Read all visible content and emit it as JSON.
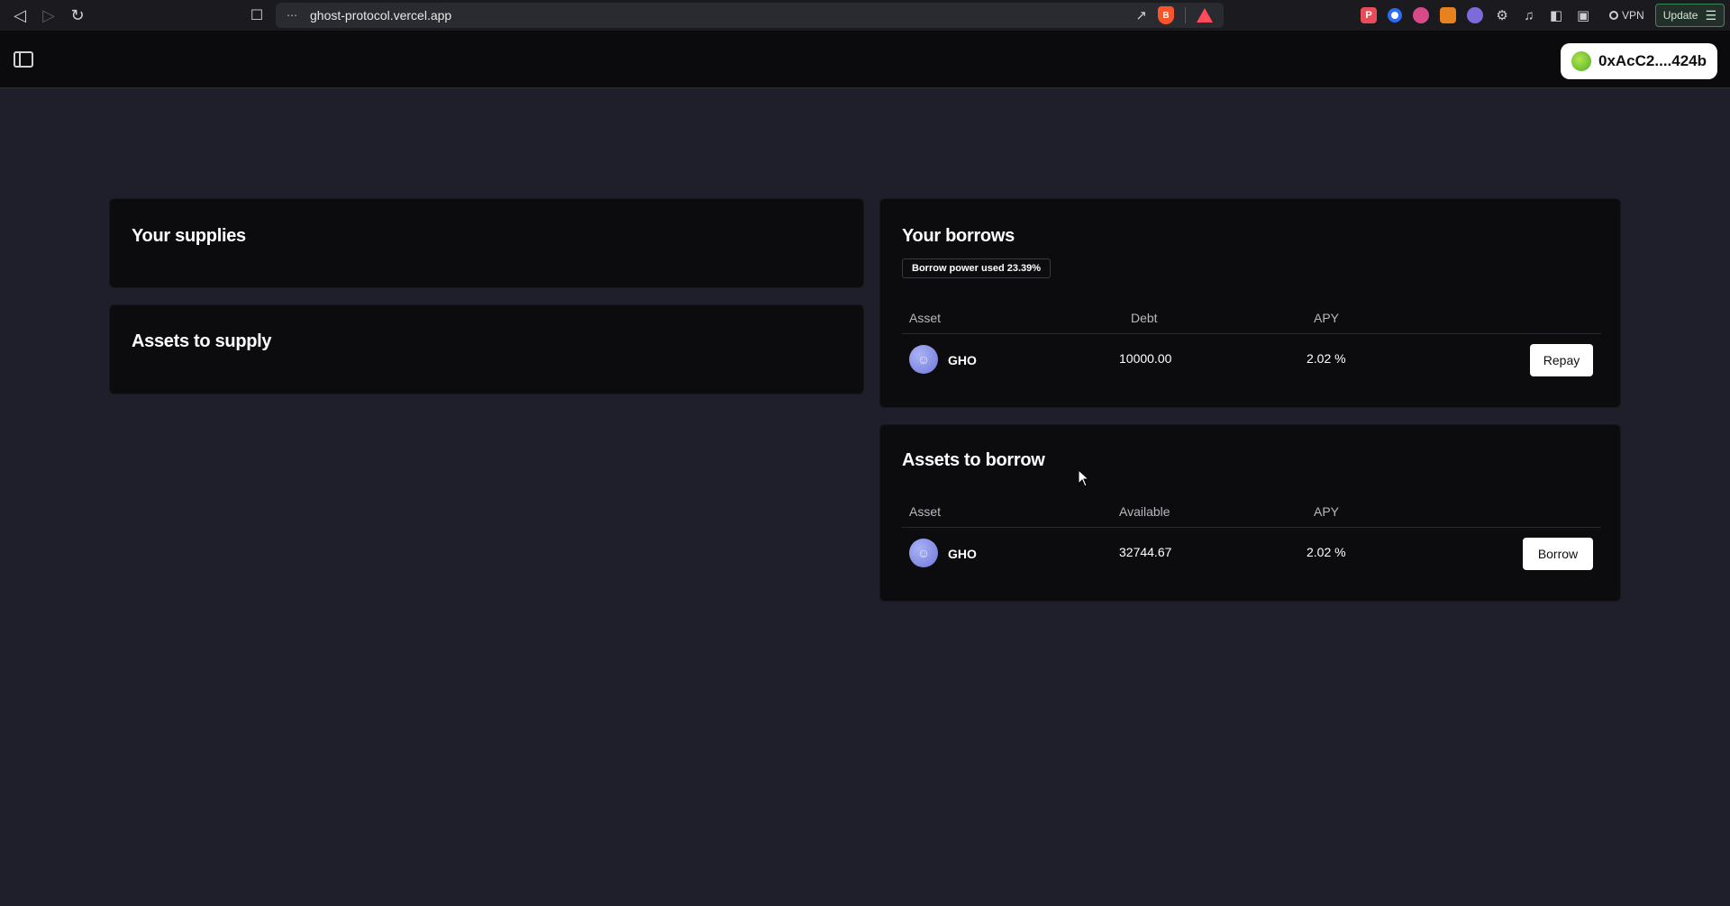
{
  "browser": {
    "url": "ghost-protocol.vercel.app",
    "vpn_label": "VPN",
    "update_label": "Update"
  },
  "header": {
    "wallet_address": "0xAcC2....424b"
  },
  "supplies": {
    "title": "Your supplies"
  },
  "assets_to_supply": {
    "title": "Assets to supply"
  },
  "borrows": {
    "title": "Your borrows",
    "badge": "Borrow power used 23.39%",
    "columns": [
      "Asset",
      "Debt",
      "APY"
    ],
    "rows": [
      {
        "asset": "GHO",
        "debt": "10000.00",
        "apy": "2.02 %",
        "action": "Repay"
      }
    ]
  },
  "assets_to_borrow": {
    "title": "Assets to borrow",
    "columns": [
      "Asset",
      "Available",
      "APY"
    ],
    "rows": [
      {
        "asset": "GHO",
        "available": "32744.67",
        "apy": "2.02 %",
        "action": "Borrow"
      }
    ]
  }
}
